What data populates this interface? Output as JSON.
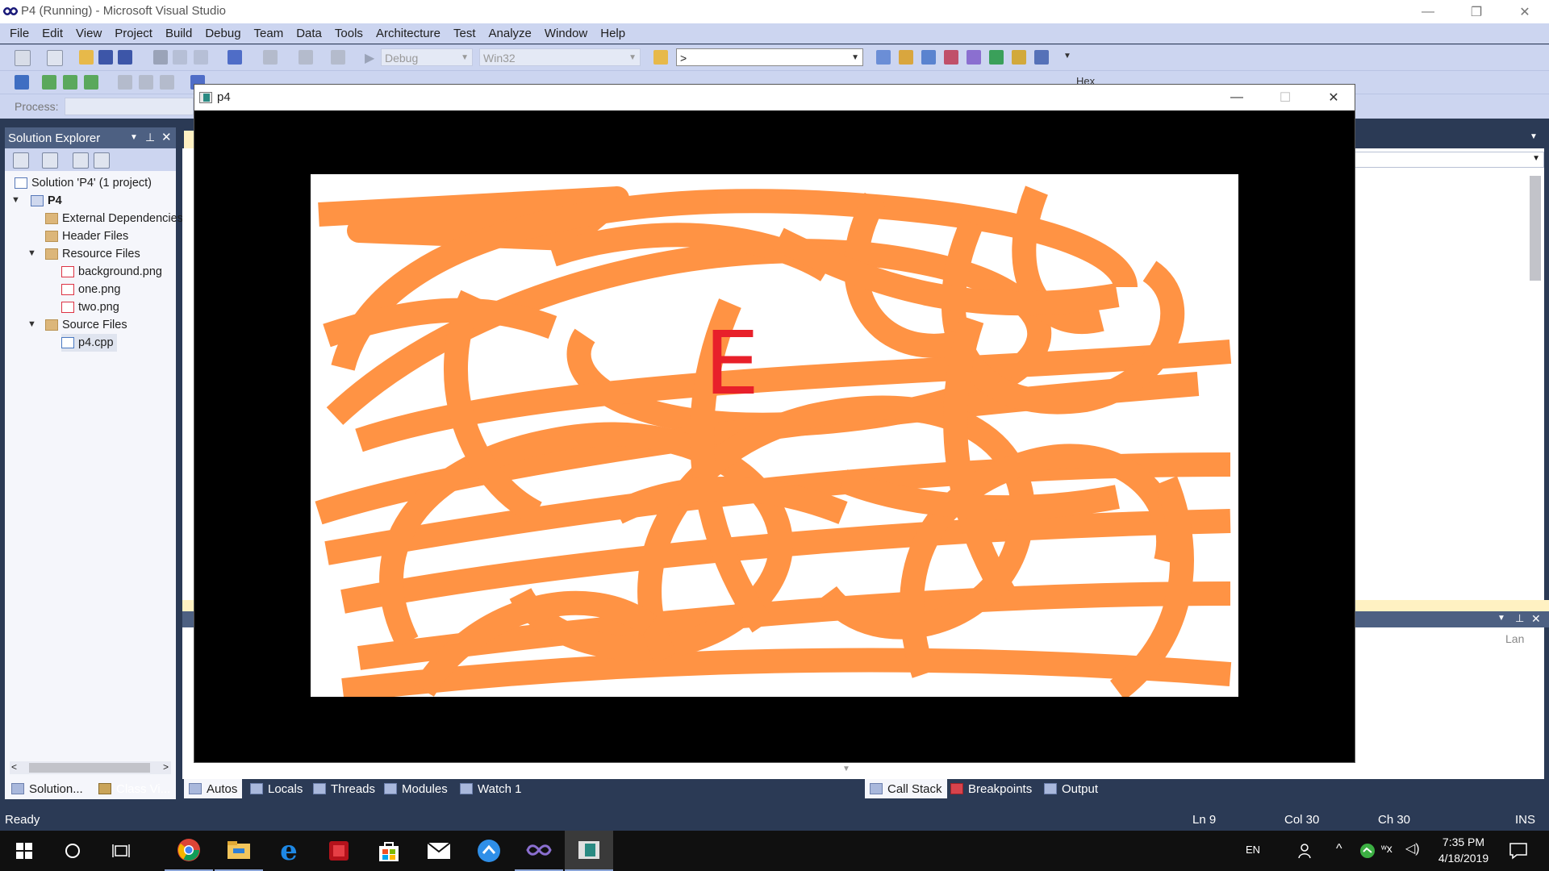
{
  "window": {
    "title": "P4 (Running) - Microsoft Visual Studio",
    "minimize_glyph": "—",
    "restore_glyph": "❐",
    "close_glyph": "✕"
  },
  "menu": [
    "File",
    "Edit",
    "View",
    "Project",
    "Build",
    "Debug",
    "Team",
    "Data",
    "Tools",
    "Architecture",
    "Test",
    "Analyze",
    "Window",
    "Help"
  ],
  "toolbar": {
    "config": "Debug",
    "platform": "Win32",
    "find_value": ">",
    "process_label": "Process:",
    "hex_label": "Hex"
  },
  "solution_explorer": {
    "title": "Solution Explorer",
    "solution": "Solution 'P4' (1 project)",
    "project": "P4",
    "items": {
      "external": "External Dependencies",
      "header": "Header Files",
      "resource": "Resource Files",
      "bg": "background.png",
      "one": "one.png",
      "two": "two.png",
      "source": "Source Files",
      "cpp": "p4.cpp"
    }
  },
  "bottom_tabs_left": {
    "solution": "Solution...",
    "classview": "Class Vi..."
  },
  "debug_tabs": [
    "Autos",
    "Locals",
    "Threads",
    "Modules",
    "Watch 1"
  ],
  "debug_tabs_right": [
    "Call Stack",
    "Breakpoints",
    "Output"
  ],
  "right_panel": {
    "lang_col": "Lan"
  },
  "status": {
    "ready": "Ready",
    "ln": "Ln 9",
    "col": "Col 30",
    "ch": "Ch 30",
    "ins": "INS"
  },
  "app_window": {
    "title": "p4",
    "letter": "E",
    "stroke_color": "#ff8c3a",
    "letter_color": "#e8202a"
  },
  "taskbar": {
    "lang": "EN",
    "time": "7:35 PM",
    "date": "4/18/2019"
  },
  "colors": {
    "menu_bg": "#ccd5f0",
    "panel_head": "#4d6082",
    "shell_bg": "#2b3a55"
  }
}
